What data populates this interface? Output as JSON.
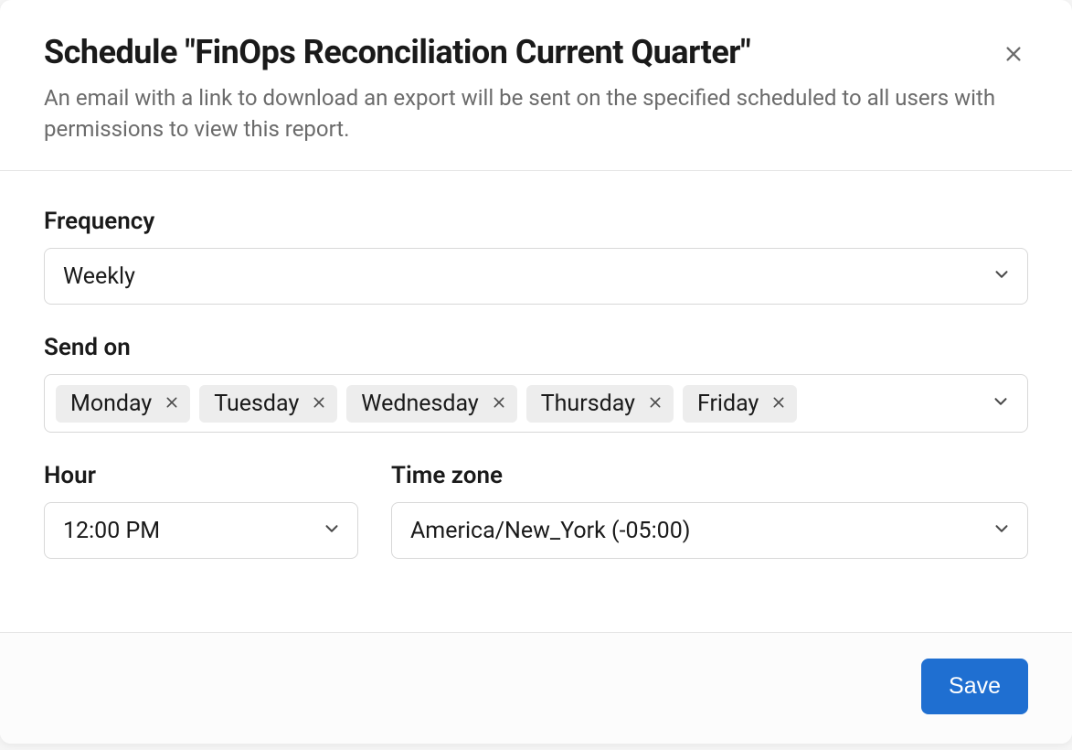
{
  "modal": {
    "title": "Schedule \"FinOps Reconciliation Current Quarter\"",
    "subtitle": "An email with a link to download an export will be sent on the specified scheduled to all users with permissions to view this report."
  },
  "form": {
    "frequency": {
      "label": "Frequency",
      "value": "Weekly"
    },
    "send_on": {
      "label": "Send on",
      "tags": [
        "Monday",
        "Tuesday",
        "Wednesday",
        "Thursday",
        "Friday"
      ]
    },
    "hour": {
      "label": "Hour",
      "value": "12:00 PM"
    },
    "timezone": {
      "label": "Time zone",
      "value": "America/New_York (-05:00)"
    }
  },
  "footer": {
    "save": "Save"
  }
}
